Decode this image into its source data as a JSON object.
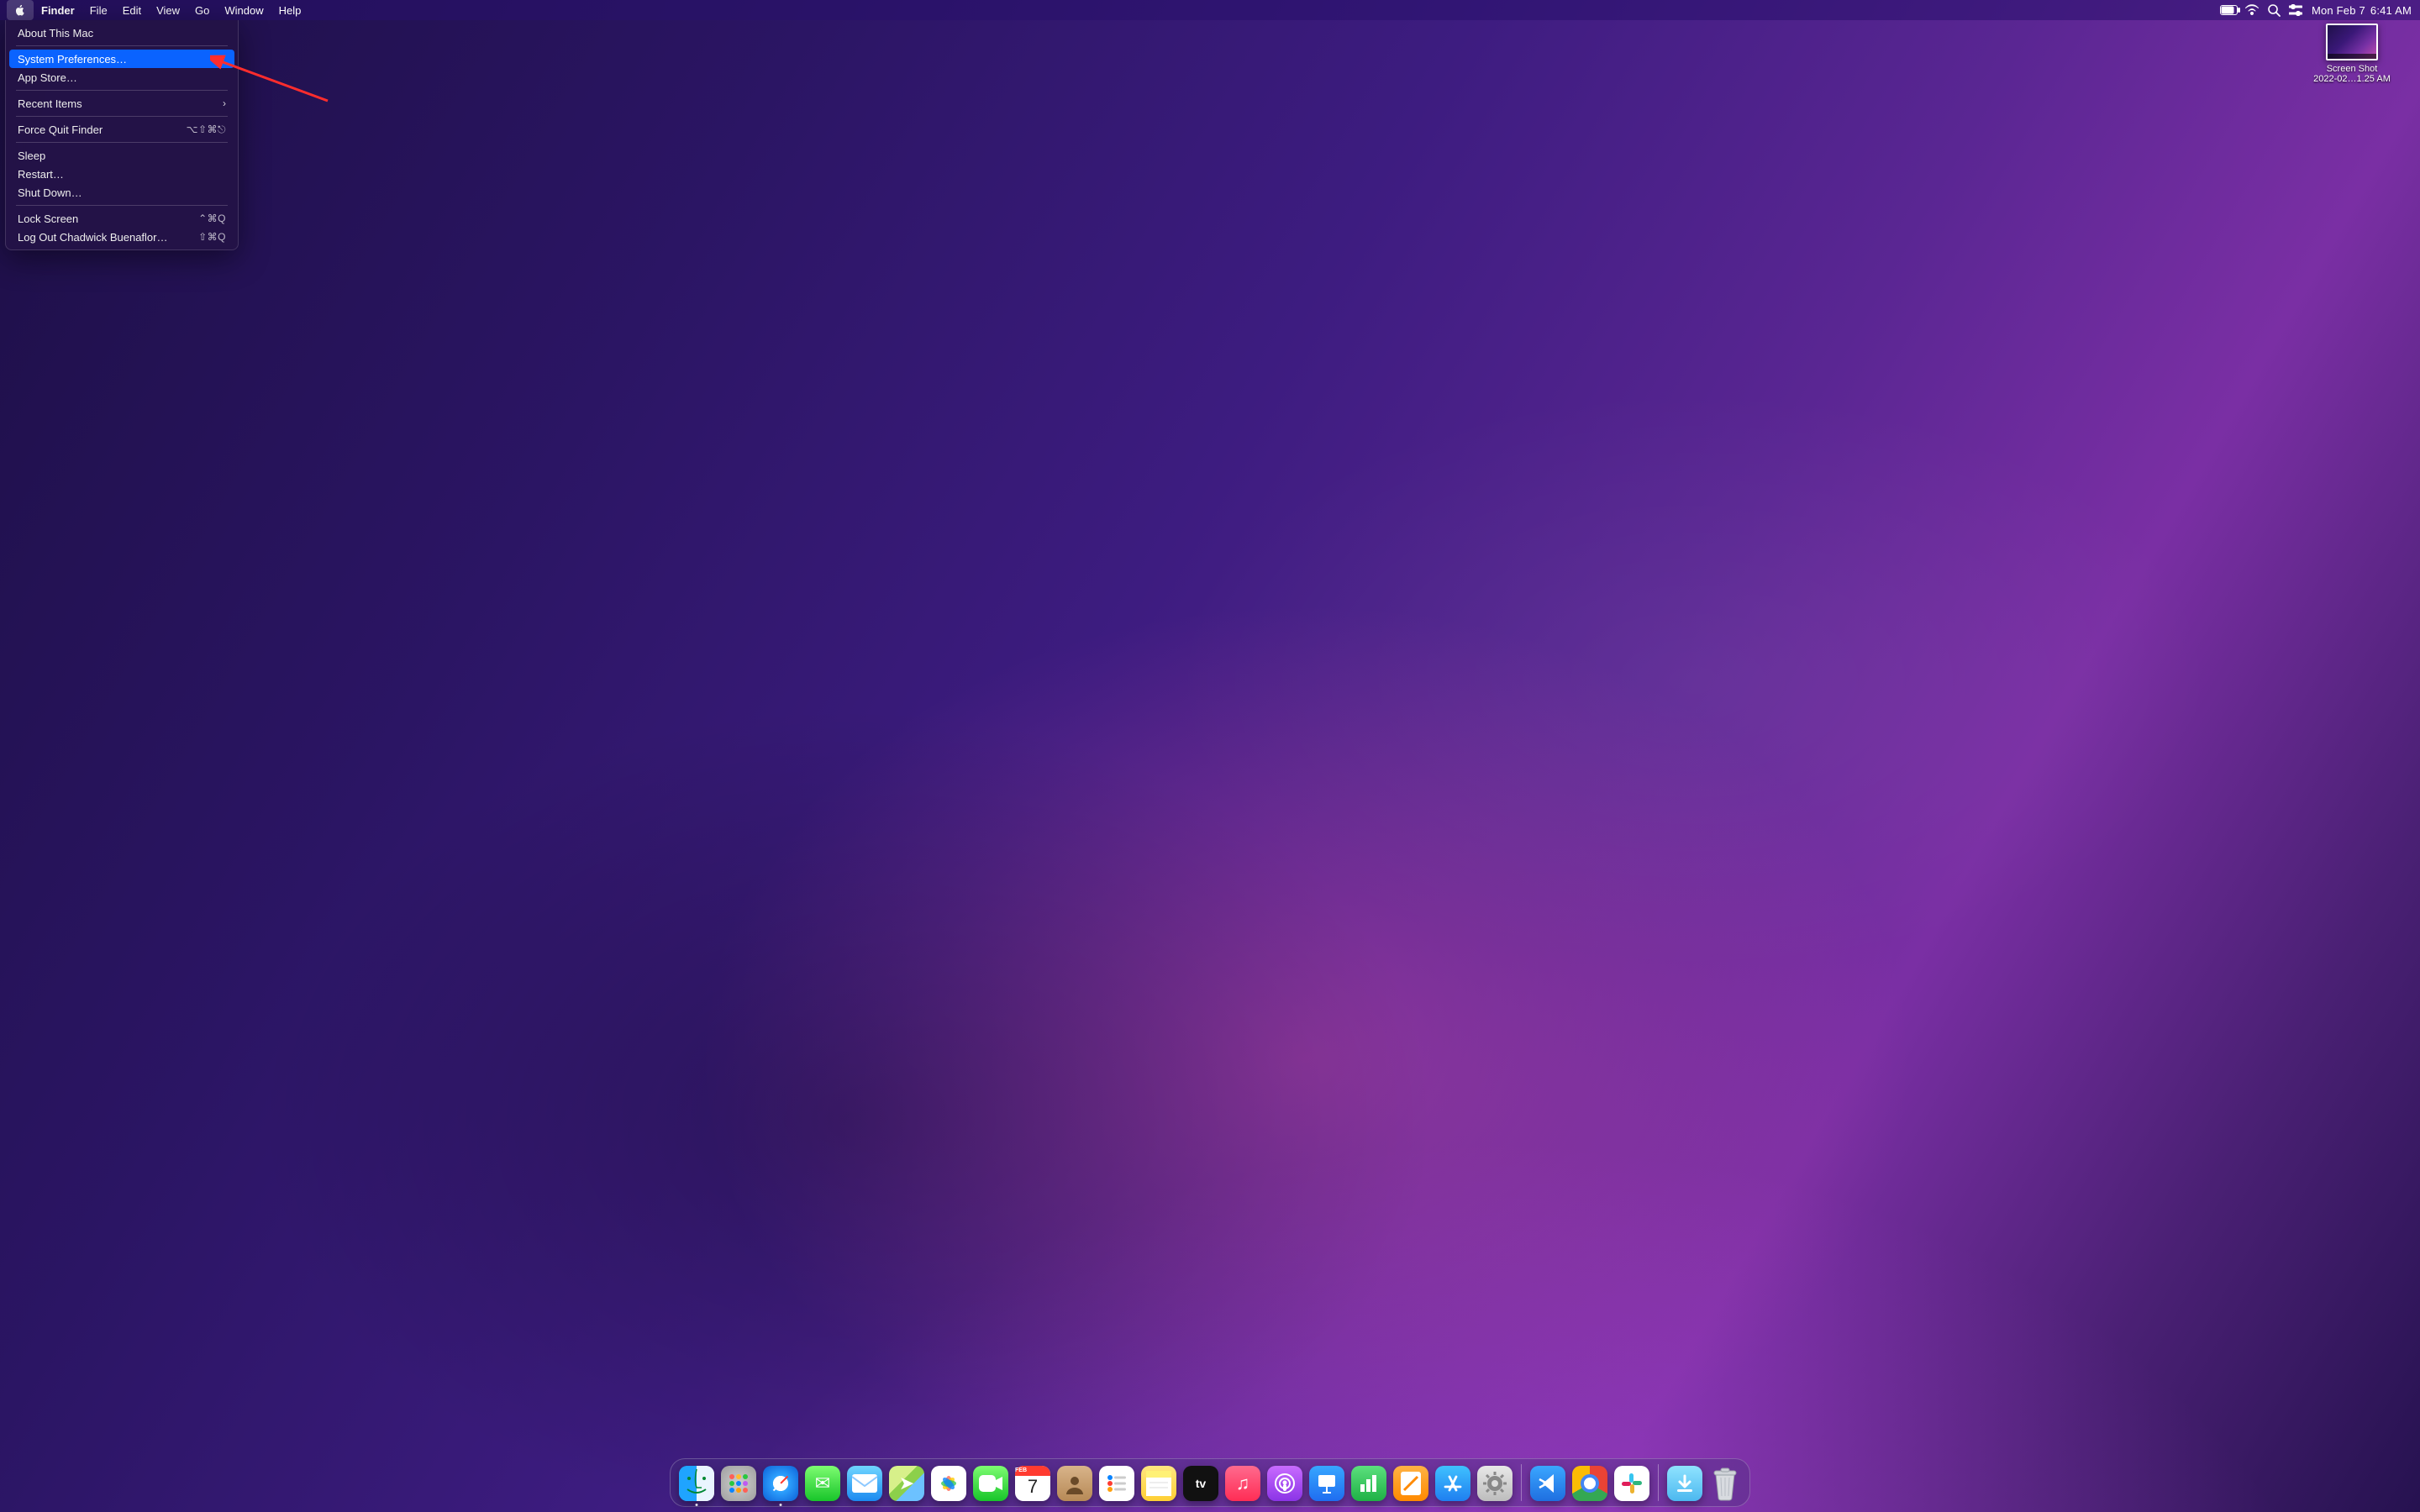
{
  "menubar": {
    "app": "Finder",
    "items": [
      "File",
      "Edit",
      "View",
      "Go",
      "Window",
      "Help"
    ],
    "date": "Mon Feb 7",
    "time": "6:41 AM"
  },
  "apple_menu": {
    "items": [
      {
        "label": "About This Mac",
        "shortcut": "",
        "submenu": false,
        "selected": false
      },
      {
        "sep": true
      },
      {
        "label": "System Preferences…",
        "shortcut": "",
        "submenu": false,
        "selected": true
      },
      {
        "label": "App Store…",
        "shortcut": "",
        "submenu": false,
        "selected": false
      },
      {
        "sep": true
      },
      {
        "label": "Recent Items",
        "shortcut": "",
        "submenu": true,
        "selected": false
      },
      {
        "sep": true
      },
      {
        "label": "Force Quit Finder",
        "shortcut": "⌥⇧⌘⎋",
        "submenu": false,
        "selected": false
      },
      {
        "sep": true
      },
      {
        "label": "Sleep",
        "shortcut": "",
        "submenu": false,
        "selected": false
      },
      {
        "label": "Restart…",
        "shortcut": "",
        "submenu": false,
        "selected": false
      },
      {
        "label": "Shut Down…",
        "shortcut": "",
        "submenu": false,
        "selected": false
      },
      {
        "sep": true
      },
      {
        "label": "Lock Screen",
        "shortcut": "⌃⌘Q",
        "submenu": false,
        "selected": false
      },
      {
        "label": "Log Out Chadwick Buenaflor…",
        "shortcut": "⇧⌘Q",
        "submenu": false,
        "selected": false
      }
    ]
  },
  "desktop_file": {
    "line1": "Screen Shot",
    "line2": "2022-02…1.25 AM"
  },
  "calendar": {
    "month": "FEB",
    "day": "7"
  },
  "dock": {
    "apps": [
      {
        "name": "finder",
        "running": true
      },
      {
        "name": "launchpad",
        "running": false
      },
      {
        "name": "safari",
        "running": true
      },
      {
        "name": "messages",
        "running": false
      },
      {
        "name": "mail",
        "running": false
      },
      {
        "name": "maps",
        "running": false
      },
      {
        "name": "photos",
        "running": false
      },
      {
        "name": "facetime",
        "running": false
      },
      {
        "name": "calendar",
        "running": false
      },
      {
        "name": "contacts",
        "running": false
      },
      {
        "name": "reminders",
        "running": false
      },
      {
        "name": "notes",
        "running": false
      },
      {
        "name": "tv",
        "running": false
      },
      {
        "name": "music",
        "running": false
      },
      {
        "name": "podcasts",
        "running": false
      },
      {
        "name": "keynote",
        "running": false
      },
      {
        "name": "numbers",
        "running": false
      },
      {
        "name": "pages",
        "running": false
      },
      {
        "name": "appstore",
        "running": false
      },
      {
        "name": "settings",
        "running": false
      }
    ],
    "extra": [
      {
        "name": "vscode"
      },
      {
        "name": "chrome"
      },
      {
        "name": "slack"
      }
    ]
  }
}
